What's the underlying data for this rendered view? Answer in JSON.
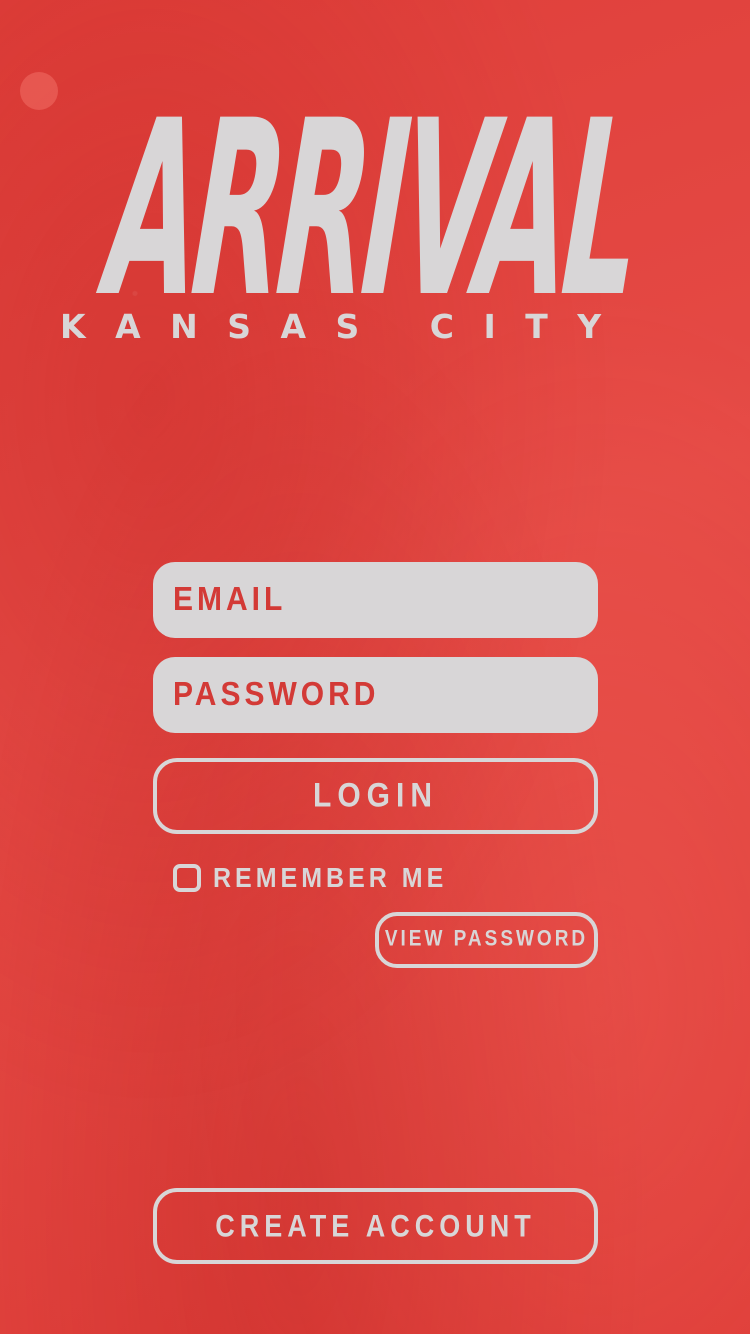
{
  "brand": {
    "title": "ARRIVAL",
    "subtitle": "KANSAS CITY"
  },
  "login_form": {
    "email_placeholder": "EMAIL",
    "password_placeholder": "PASSWORD",
    "login_label": "LOGIN",
    "remember_label": "REMEMBER ME",
    "remember_checked": false,
    "view_password_label": "VIEW PASSWORD"
  },
  "footer": {
    "create_account_label": "CREATE ACCOUNT"
  },
  "colors": {
    "background": "#e24540",
    "foreground": "#d8d6d7",
    "accent_text": "#d33a36"
  }
}
